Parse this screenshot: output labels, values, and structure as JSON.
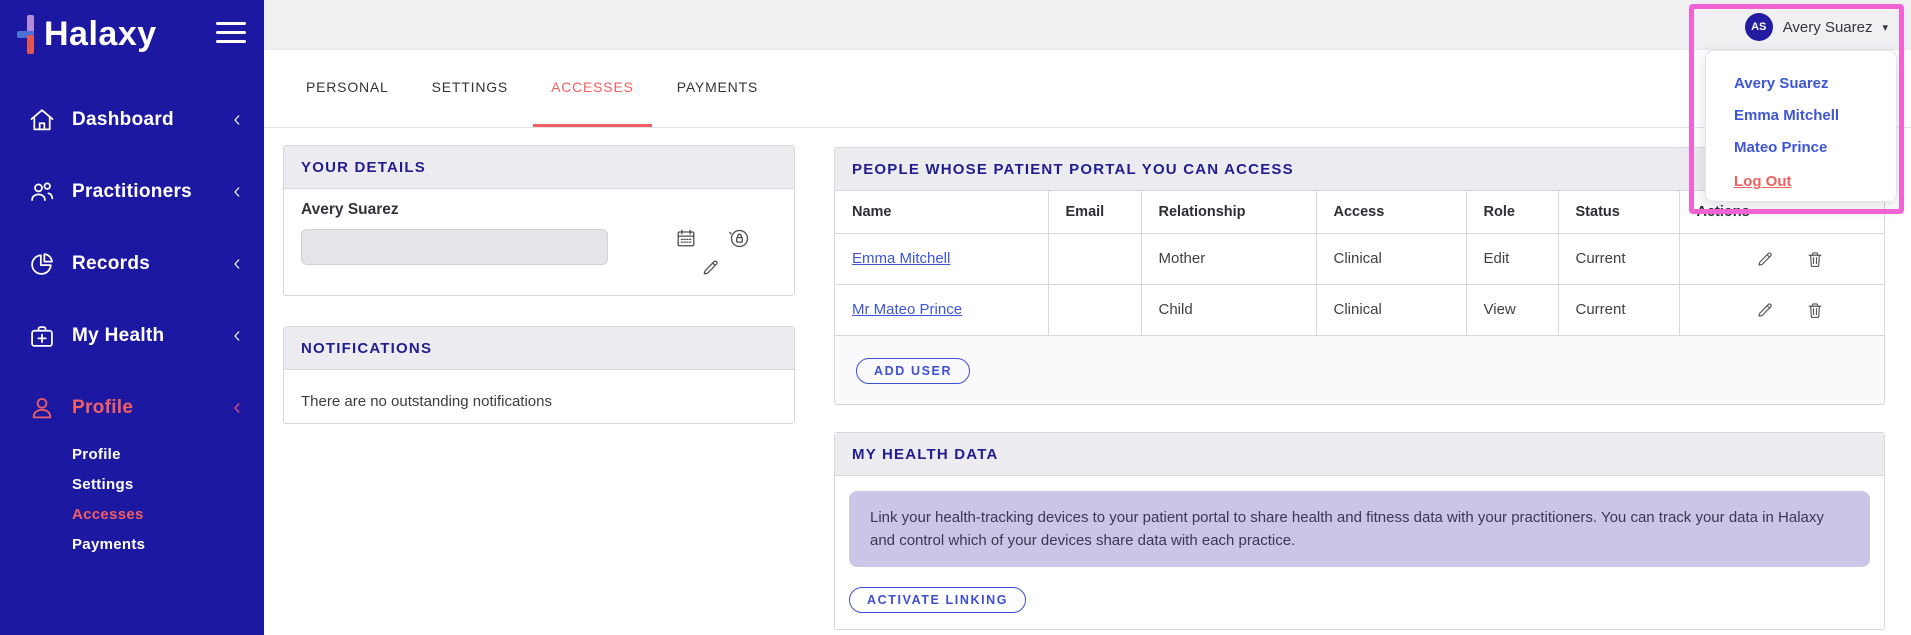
{
  "sidebar": {
    "logo_text": "Halaxy",
    "items": [
      {
        "label": "Dashboard",
        "icon": "home-icon"
      },
      {
        "label": "Practitioners",
        "icon": "practitioners-icon"
      },
      {
        "label": "Records",
        "icon": "records-icon"
      },
      {
        "label": "My Health",
        "icon": "my-health-icon"
      },
      {
        "label": "Profile",
        "icon": "profile-icon"
      }
    ],
    "sub_items": [
      {
        "label": "Profile",
        "active": false
      },
      {
        "label": "Settings",
        "active": false
      },
      {
        "label": "Accesses",
        "active": true
      },
      {
        "label": "Payments",
        "active": false
      }
    ]
  },
  "header": {
    "user_initials": "AS",
    "user_name": "Avery Suarez",
    "caret_glyph": "▾"
  },
  "tabs": [
    {
      "label": "PERSONAL",
      "active": false
    },
    {
      "label": "SETTINGS",
      "active": false
    },
    {
      "label": "ACCESSES",
      "active": true
    },
    {
      "label": "PAYMENTS",
      "active": false
    }
  ],
  "user_menu": {
    "items": [
      {
        "label": "Avery Suarez"
      },
      {
        "label": "Emma Mitchell"
      },
      {
        "label": "Mateo Prince"
      }
    ],
    "logout_label": "Log Out"
  },
  "your_details": {
    "title": "YOUR DETAILS",
    "name": "Avery Suarez",
    "field_value": ""
  },
  "notifications": {
    "title": "NOTIFICATIONS",
    "message": "There are no outstanding notifications"
  },
  "access_table": {
    "title": "PEOPLE WHOSE PATIENT PORTAL YOU CAN ACCESS",
    "columns": [
      "Name",
      "Email",
      "Relationship",
      "Access",
      "Role",
      "Status",
      "Actions"
    ],
    "rows": [
      {
        "name": "Emma Mitchell",
        "email": "",
        "relationship": "Mother",
        "access": "Clinical",
        "role": "Edit",
        "status": "Current"
      },
      {
        "name": "Mr Mateo Prince",
        "email": "",
        "relationship": "Child",
        "access": "Clinical",
        "role": "View",
        "status": "Current"
      }
    ],
    "add_user_label": "ADD USER"
  },
  "health_data": {
    "title": "MY HEALTH DATA",
    "info": "Link your health-tracking devices to your patient portal to share health and fitness data with your practitioners. You can track your data in Halaxy and control which of your devices share data with each practice.",
    "activate_label": "ACTIVATE LINKING"
  },
  "colors": {
    "sidebar_bg": "#1d18a1",
    "brand_navy": "#211d8e",
    "accent_coral": "#ef6161",
    "link_blue": "#3e55d6",
    "button_blue": "#3e4fd2",
    "annotation_pink": "#ef63d5",
    "lavender_info": "#c9c6e8",
    "topbar_gray": "#f0f0f3"
  }
}
